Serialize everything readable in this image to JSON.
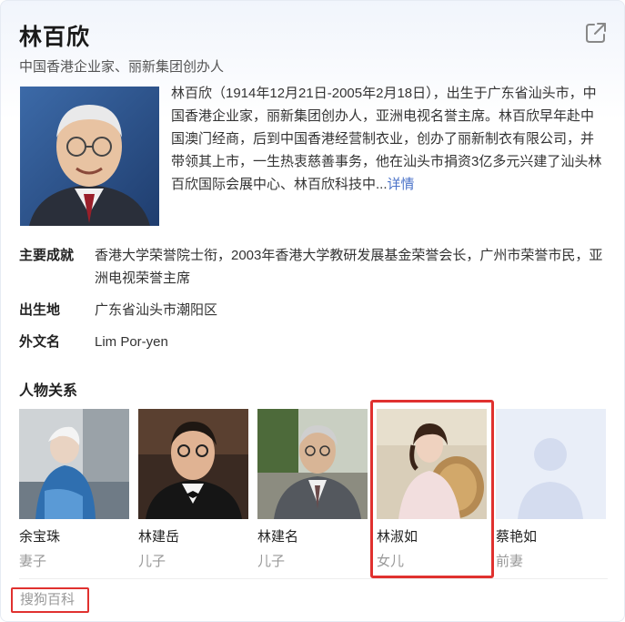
{
  "header": {
    "title": "林百欣",
    "subtitle": "中国香港企业家、丽新集团创办人"
  },
  "summary": {
    "text": "林百欣（1914年12月21日-2005年2月18日），出生于广东省汕头市，中国香港企业家，丽新集团创办人，亚洲电视名誉主席。林百欣早年赴中国澳门经商，后到中国香港经营制衣业，创办了丽新制衣有限公司，并带领其上市，一生热衷慈善事务，他在汕头市捐资3亿多元兴建了汕头林百欣国际会展中心、林百欣科技中...",
    "more_label": "详情"
  },
  "facts": [
    {
      "key": "主要成就",
      "value": "香港大学荣誉院士衔，2003年香港大学教研发展基金荣誉会长，广州市荣誉市民，亚洲电视荣誉主席"
    },
    {
      "key": "出生地",
      "value": "广东省汕头市潮阳区"
    },
    {
      "key": "外文名",
      "value": "Lim Por-yen"
    }
  ],
  "relations": {
    "heading": "人物关系",
    "people": [
      {
        "name": "余宝珠",
        "role": "妻子"
      },
      {
        "name": "林建岳",
        "role": "儿子"
      },
      {
        "name": "林建名",
        "role": "儿子"
      },
      {
        "name": "林淑如",
        "role": "女儿"
      },
      {
        "name": "蔡艳如",
        "role": "前妻"
      }
    ]
  },
  "footer": {
    "source_label": "搜狗百科"
  },
  "colors": {
    "highlight": "#e0312f",
    "link": "#4a72c8",
    "muted": "#999999"
  },
  "icons": {
    "share": "share-external-icon",
    "placeholder_avatar": "person-placeholder-icon"
  }
}
